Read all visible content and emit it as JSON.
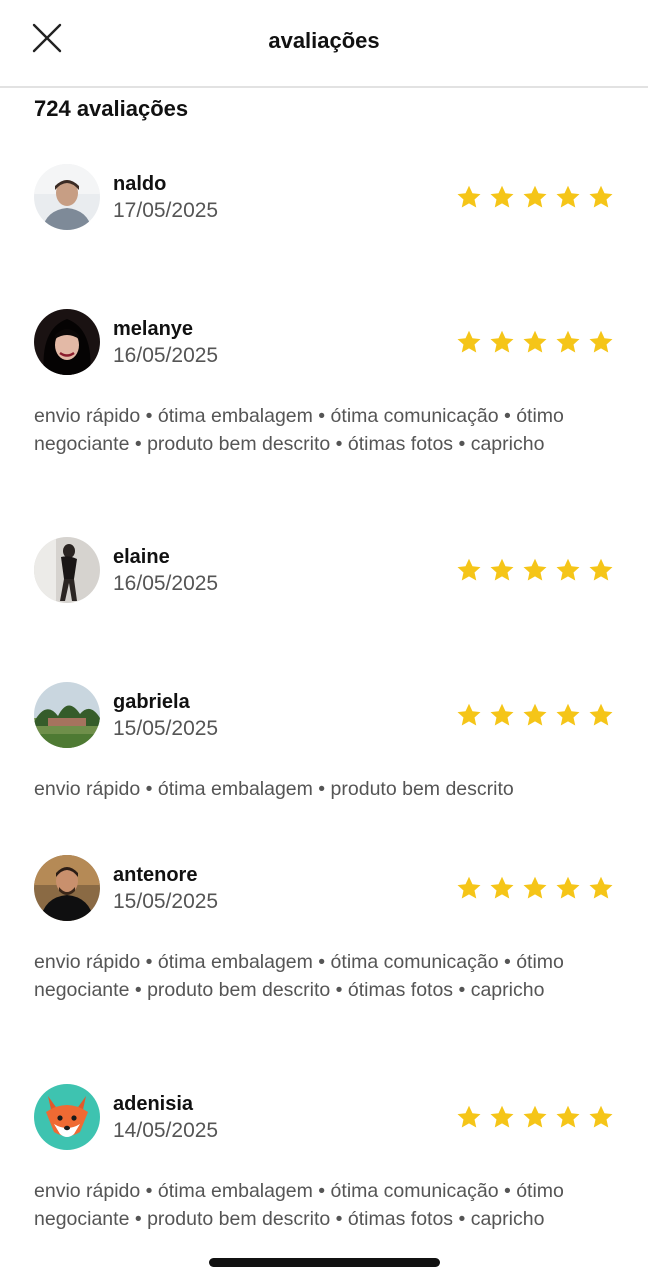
{
  "header": {
    "title": "avaliações",
    "close_icon": "close-icon"
  },
  "summary": {
    "count_text": "724 avaliações"
  },
  "star_color": "#F5C518",
  "reviews": [
    {
      "username": "naldo",
      "date": "17/05/2025",
      "rating": 5,
      "tags": ""
    },
    {
      "username": "melanye",
      "date": "16/05/2025",
      "rating": 5,
      "tags": "envio rápido • ótima embalagem • ótima comunicação • ótimo negociante • produto bem descrito • ótimas fotos • capricho"
    },
    {
      "username": "elaine",
      "date": "16/05/2025",
      "rating": 5,
      "tags": ""
    },
    {
      "username": "gabriela",
      "date": "15/05/2025",
      "rating": 5,
      "tags": "envio rápido • ótima embalagem • produto bem descrito"
    },
    {
      "username": "antenore",
      "date": "15/05/2025",
      "rating": 5,
      "tags": "envio rápido • ótima embalagem • ótima comunicação • ótimo negociante • produto bem descrito • ótimas fotos • capricho"
    },
    {
      "username": "adenisia",
      "date": "14/05/2025",
      "rating": 5,
      "tags": "envio rápido • ótima embalagem • ótima comunicação • ótimo negociante • produto bem descrito • ótimas fotos • capricho"
    }
  ]
}
